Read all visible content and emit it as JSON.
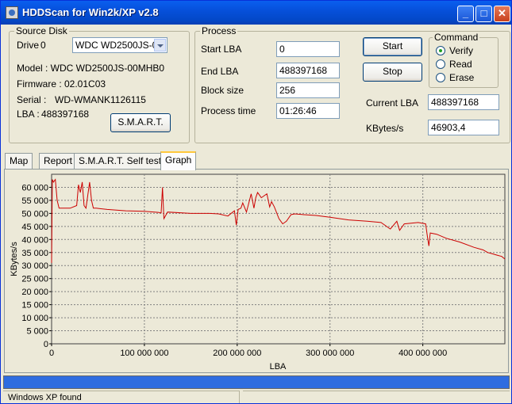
{
  "window": {
    "title": "HDDScan for Win2k/XP  v2.8",
    "minimize": "_",
    "maximize": "□",
    "close": "✕"
  },
  "source_disk": {
    "group_label": "Source Disk",
    "drive_label": "Drive",
    "drive_number": "0",
    "drive_select": "WDC WD2500JS-0",
    "model": "Model : WDC WD2500JS-00MHB0",
    "firmware": "Firmware : 02.01C03",
    "serial_label": "Serial :",
    "serial_value": "WD-WMANK1126115",
    "lba_label": "LBA :",
    "lba_value": "488397168",
    "smart_button": "S.M.A.R.T."
  },
  "process": {
    "group_label": "Process",
    "start_lba_label": "Start LBA",
    "start_lba": "0",
    "end_lba_label": "End LBA",
    "end_lba": "488397168",
    "block_size_label": "Block size",
    "block_size": "256",
    "process_time_label": "Process time",
    "process_time": "01:26:46",
    "start_button": "Start",
    "stop_button": "Stop",
    "current_lba_label": "Current LBA",
    "current_lba": "488397168",
    "kbytes_label": "KBytes/s",
    "kbytes": "46903,4"
  },
  "command": {
    "group_label": "Command",
    "options": [
      {
        "label": "Verify",
        "checked": true
      },
      {
        "label": "Read",
        "checked": false
      },
      {
        "label": "Erase",
        "checked": false
      }
    ]
  },
  "tabs": [
    {
      "label": "Map",
      "active": false
    },
    {
      "label": "Report",
      "active": false
    },
    {
      "label": "S.M.A.R.T. Self tests",
      "active": false
    },
    {
      "label": "Graph",
      "active": true
    }
  ],
  "progress": {
    "fraction": 1.0
  },
  "status_bar": {
    "message": "Windows XP found"
  },
  "colors": {
    "line": "#cc0000",
    "plot_bg": "#ECE9D8",
    "grid": "#808080",
    "progress": "#2f6de0"
  },
  "chart_data": {
    "type": "line",
    "title": "",
    "xlabel": "LBA",
    "ylabel": "KBytes/s",
    "xlim": [
      0,
      488397168
    ],
    "ylim": [
      0,
      65000
    ],
    "grid": true,
    "x_ticks": [
      {
        "value": 0,
        "label": "0"
      },
      {
        "value": 100000000,
        "label": "100 000 000"
      },
      {
        "value": 200000000,
        "label": "200 000 000"
      },
      {
        "value": 300000000,
        "label": "300 000 000"
      },
      {
        "value": 400000000,
        "label": "400 000 000"
      }
    ],
    "y_ticks": [
      {
        "value": 0,
        "label": "0"
      },
      {
        "value": 5000,
        "label": "5 000"
      },
      {
        "value": 10000,
        "label": "10 000"
      },
      {
        "value": 15000,
        "label": "15 000"
      },
      {
        "value": 20000,
        "label": "20 000"
      },
      {
        "value": 25000,
        "label": "25 000"
      },
      {
        "value": 30000,
        "label": "30 000"
      },
      {
        "value": 35000,
        "label": "35 000"
      },
      {
        "value": 40000,
        "label": "40 000"
      },
      {
        "value": 45000,
        "label": "45 000"
      },
      {
        "value": 50000,
        "label": "50 000"
      },
      {
        "value": 55000,
        "label": "55 000"
      },
      {
        "value": 60000,
        "label": "60 000"
      }
    ],
    "series": [
      {
        "x": [
          0,
          800000,
          2000000,
          4000000,
          6000000,
          8000000,
          12000000,
          20000000,
          27000000,
          29000000,
          31000000,
          33000000,
          35000000,
          37000000,
          41000000,
          43000000,
          45000000,
          48000000,
          60000000,
          80000000,
          100000000,
          115000000,
          118000000,
          119500000,
          121000000,
          125000000,
          150000000,
          170000000,
          180000000,
          190000000,
          197000000,
          199000000,
          201000000,
          204000000,
          206000000,
          210000000,
          215000000,
          218000000,
          220000000,
          222000000,
          224000000,
          226000000,
          232000000,
          235000000,
          237000000,
          240000000,
          245000000,
          249000000,
          253000000,
          258000000,
          262000000,
          272000000,
          285000000,
          300000000,
          320000000,
          340000000,
          355000000,
          365000000,
          372000000,
          375000000,
          380000000,
          395000000,
          403000000,
          405000000,
          406500000,
          408000000,
          415000000,
          425000000,
          440000000,
          455000000,
          465000000,
          470000000,
          475000000,
          480000000,
          485000000,
          488397168
        ],
        "y": [
          31000,
          63000,
          62000,
          63000,
          55000,
          52000,
          52000,
          52000,
          53000,
          61000,
          58000,
          62000,
          53000,
          52000,
          62000,
          55000,
          52000,
          52000,
          51500,
          51000,
          50800,
          50400,
          50200,
          60000,
          48000,
          50500,
          50000,
          50000,
          49800,
          49000,
          51000,
          45500,
          51500,
          52000,
          54000,
          50500,
          57500,
          52000,
          56000,
          58000,
          57000,
          56000,
          57500,
          52500,
          54500,
          52500,
          48000,
          46000,
          47000,
          49500,
          49800,
          49500,
          49200,
          48500,
          47500,
          47000,
          46500,
          44000,
          47000,
          43500,
          46000,
          46500,
          46000,
          41000,
          37500,
          42500,
          42000,
          40500,
          39000,
          37000,
          36000,
          35000,
          34500,
          34000,
          33500,
          32500
        ]
      }
    ]
  }
}
